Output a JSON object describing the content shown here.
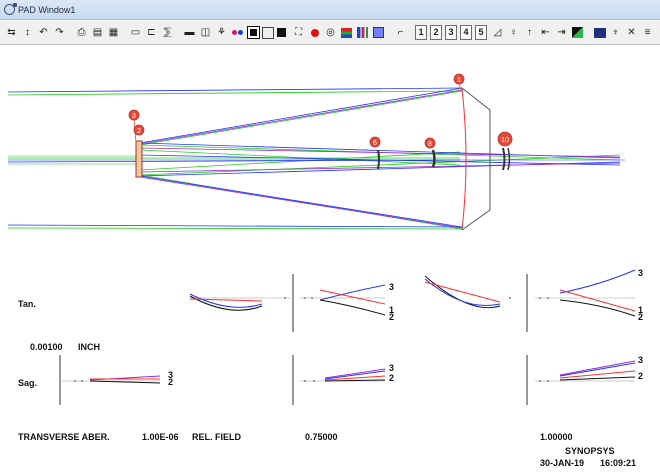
{
  "window": {
    "title": "PAD Window1"
  },
  "toolbar": {
    "buttons": [
      "adjust-icon",
      "spin-icon",
      "undo-icon",
      "redo-icon",
      "print-icon",
      "print-preview-icon",
      "grid-icon",
      "display-icon",
      "scale-icon",
      "text-icon",
      "ruler-icon",
      "lens-icon",
      "rays-icon",
      "dots-icon",
      "square-open-icon",
      "square-filled-icon",
      "zoom-icon",
      "record-icon",
      "target-icon",
      "stack-icon",
      "bars-icon",
      "palette-icon"
    ],
    "numbers": [
      "1",
      "2",
      "3",
      "4",
      "5"
    ],
    "buttons_right": [
      "wave-icon",
      "probe-icon",
      "arrow-up-icon",
      "expand-icon",
      "shrink-icon",
      "color-map-icon",
      "menu-icon",
      "flag-icon",
      "close-icon",
      "equals-icon"
    ]
  },
  "layout_labels": {
    "surface_markers": [
      "1",
      "2",
      "3",
      "6",
      "8",
      "10"
    ]
  },
  "aberration": {
    "tan_label": "Tan.",
    "sag_label": "Sag.",
    "scale_value": "0.00100",
    "scale_unit": "INCH",
    "tan_curve_labels": [
      "3",
      "1",
      "2"
    ],
    "tan_curve_labels_right": [
      "3",
      "1",
      "2"
    ],
    "sag_curve_labels": [
      "3",
      "2"
    ],
    "sag_curve_labels_mid": [
      "3",
      "2"
    ],
    "sag_curve_labels_right": [
      "3",
      "2"
    ]
  },
  "footer": {
    "aber_type": "TRANSVERSE ABER.",
    "wavelength": "1.00E-06",
    "rel_field_label": "REL. FIELD",
    "field_mid": "0.75000",
    "field_full": "1.00000",
    "brand": "SYNOPSYS",
    "date": "30-JAN-19",
    "time": "16:09:21"
  },
  "colors": {
    "ray_green": "#22cc22",
    "ray_blue": "#2233ff",
    "ray_purple": "#9a2bd1",
    "ray_red": "#ff3030",
    "lens_dark": "#333333",
    "marker_red": "#e64a36"
  }
}
